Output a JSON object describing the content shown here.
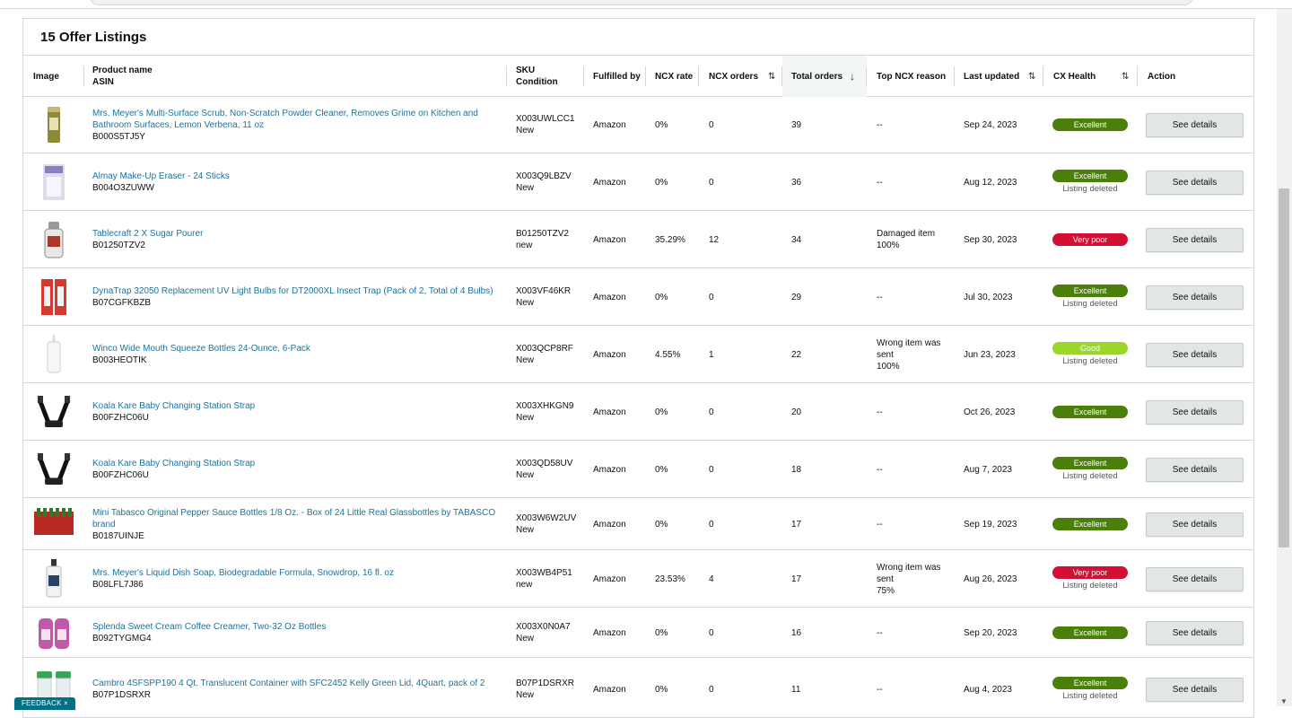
{
  "panel": {
    "title": "15 Offer Listings"
  },
  "columns": {
    "image": "Image",
    "product_name": "Product name",
    "asin": "ASIN",
    "sku": "SKU",
    "condition": "Condition",
    "fulfilled_by": "Fulfilled by",
    "ncx_rate": "NCX rate",
    "ncx_orders": "NCX orders",
    "total_orders": "Total orders",
    "top_ncx_reason": "Top NCX reason",
    "last_updated": "Last updated",
    "cx_health": "CX Health",
    "action": "Action"
  },
  "colors": {
    "excellent": "#4a7f0a",
    "very_poor": "#d31034",
    "good": "#9ad62b",
    "link": "#217399"
  },
  "rows": [
    {
      "name_lines": [
        "Mrs. Meyer's Multi-Surface Scrub, Non-Scratch Powder Cleaner, Removes Grime on Kitchen and",
        "Bathroom Surfaces, Lemon Verbena, 11 oz"
      ],
      "asin": "B000S5TJ5Y",
      "sku": "X003UWLCC1",
      "condition": "New",
      "fulfilled": "Amazon",
      "ncx_rate": "0%",
      "ncx_orders": "0",
      "total_orders": "39",
      "reason_lines": [
        "--"
      ],
      "updated": "Sep 24, 2023",
      "health": "Excellent",
      "health_class": "excellent",
      "note": "",
      "action": "See details",
      "icon": "scrub-canister-icon"
    },
    {
      "name_lines": [
        "Almay Make-Up Eraser - 24 Sticks"
      ],
      "asin": "B004O3ZUWW",
      "sku": "X003Q9LBZV",
      "condition": "New",
      "fulfilled": "Amazon",
      "ncx_rate": "0%",
      "ncx_orders": "0",
      "total_orders": "36",
      "reason_lines": [
        "--"
      ],
      "updated": "Aug 12, 2023",
      "health": "Excellent",
      "health_class": "excellent",
      "note": "Listing deleted",
      "action": "See details",
      "icon": "makeup-box-icon"
    },
    {
      "name_lines": [
        "Tablecraft 2 X Sugar Pourer"
      ],
      "asin": "B01250TZV2",
      "sku": "B01250TZV2",
      "condition": "new",
      "fulfilled": "Amazon",
      "ncx_rate": "35.29%",
      "ncx_orders": "12",
      "total_orders": "34",
      "reason_lines": [
        "Damaged item",
        "100%"
      ],
      "updated": "Sep 30, 2023",
      "health": "Very poor",
      "health_class": "verypoor",
      "note": "",
      "action": "See details",
      "icon": "sugar-pourer-icon"
    },
    {
      "name_lines": [
        "DynaTrap 32050 Replacement UV Light Bulbs for DT2000XL Insect Trap (Pack of 2, Total of 4 Bulbs)"
      ],
      "asin": "B07CGFKBZB",
      "sku": "X003VF46KR",
      "condition": "New",
      "fulfilled": "Amazon",
      "ncx_rate": "0%",
      "ncx_orders": "0",
      "total_orders": "29",
      "reason_lines": [
        "--"
      ],
      "updated": "Jul 30, 2023",
      "health": "Excellent",
      "health_class": "excellent",
      "note": "Listing deleted",
      "action": "See details",
      "icon": "bulb-pack-icon"
    },
    {
      "name_lines": [
        "Winco Wide Mouth Squeeze Bottles 24-Ounce, 6-Pack"
      ],
      "asin": "B003HEOTIK",
      "sku": "X003QCP8RF",
      "condition": "New",
      "fulfilled": "Amazon",
      "ncx_rate": "4.55%",
      "ncx_orders": "1",
      "total_orders": "22",
      "reason_lines": [
        "Wrong item was",
        "sent",
        "100%"
      ],
      "updated": "Jun 23, 2023",
      "health": "Good",
      "health_class": "good",
      "note": "Listing deleted",
      "action": "See details",
      "icon": "squeeze-bottle-icon"
    },
    {
      "name_lines": [
        "Koala Kare Baby Changing Station Strap"
      ],
      "asin": "B00FZHC06U",
      "sku": "X003XHKGN9",
      "condition": "New",
      "fulfilled": "Amazon",
      "ncx_rate": "0%",
      "ncx_orders": "0",
      "total_orders": "20",
      "reason_lines": [
        "--"
      ],
      "updated": "Oct 26, 2023",
      "health": "Excellent",
      "health_class": "excellent",
      "note": "",
      "action": "See details",
      "icon": "strap-icon"
    },
    {
      "name_lines": [
        "Koala Kare Baby Changing Station Strap"
      ],
      "asin": "B00FZHC06U",
      "sku": "X003QD58UV",
      "condition": "New",
      "fulfilled": "Amazon",
      "ncx_rate": "0%",
      "ncx_orders": "0",
      "total_orders": "18",
      "reason_lines": [
        "--"
      ],
      "updated": "Aug 7, 2023",
      "health": "Excellent",
      "health_class": "excellent",
      "note": "Listing deleted",
      "action": "See details",
      "icon": "strap-icon"
    },
    {
      "name_lines": [
        "Mini Tabasco Original Pepper Sauce Bottles 1/8 Oz. - Box of 24 Little Real Glassbottles by TABASCO",
        "brand"
      ],
      "asin": "B0187UINJE",
      "sku": "X003W6W2UV",
      "condition": "New",
      "fulfilled": "Amazon",
      "ncx_rate": "0%",
      "ncx_orders": "0",
      "total_orders": "17",
      "reason_lines": [
        "--"
      ],
      "updated": "Sep 19, 2023",
      "health": "Excellent",
      "health_class": "excellent",
      "note": "",
      "action": "See details",
      "icon": "tabasco-box-icon"
    },
    {
      "name_lines": [
        "Mrs. Meyer's Liquid Dish Soap, Biodegradable Formula, Snowdrop, 16 fl. oz"
      ],
      "asin": "B08LFL7J86",
      "sku": "X003WB4P51",
      "condition": "new",
      "fulfilled": "Amazon",
      "ncx_rate": "23.53%",
      "ncx_orders": "4",
      "total_orders": "17",
      "reason_lines": [
        "Wrong item was",
        "sent",
        "75%"
      ],
      "updated": "Aug 26, 2023",
      "health": "Very poor",
      "health_class": "verypoor",
      "note": "Listing deleted",
      "action": "See details",
      "icon": "soap-bottle-icon"
    },
    {
      "name_lines": [
        "Splenda Sweet Cream Coffee Creamer, Two-32 Oz Bottles"
      ],
      "asin": "B092TYGMG4",
      "sku": "X003X0N0A7",
      "condition": "New",
      "fulfilled": "Amazon",
      "ncx_rate": "0%",
      "ncx_orders": "0",
      "total_orders": "16",
      "reason_lines": [
        "--"
      ],
      "updated": "Sep 20, 2023",
      "health": "Excellent",
      "health_class": "excellent",
      "note": "",
      "action": "See details",
      "icon": "creamer-bottles-icon"
    },
    {
      "name_lines": [
        "Cambro 4SFSPP190 4 Qt. Translucent Container with SFC2452 Kelly Green Lid, 4Quart, pack of 2"
      ],
      "asin": "B07P1DSRXR",
      "sku": "B07P1DSRXR",
      "condition": "New",
      "fulfilled": "Amazon",
      "ncx_rate": "0%",
      "ncx_orders": "0",
      "total_orders": "11",
      "reason_lines": [
        "--"
      ],
      "updated": "Aug 4, 2023",
      "health": "Excellent",
      "health_class": "excellent",
      "note": "Listing deleted",
      "action": "See details",
      "icon": "container-icon"
    }
  ],
  "feedback": {
    "label": "FEEDBACK",
    "close": "×"
  }
}
